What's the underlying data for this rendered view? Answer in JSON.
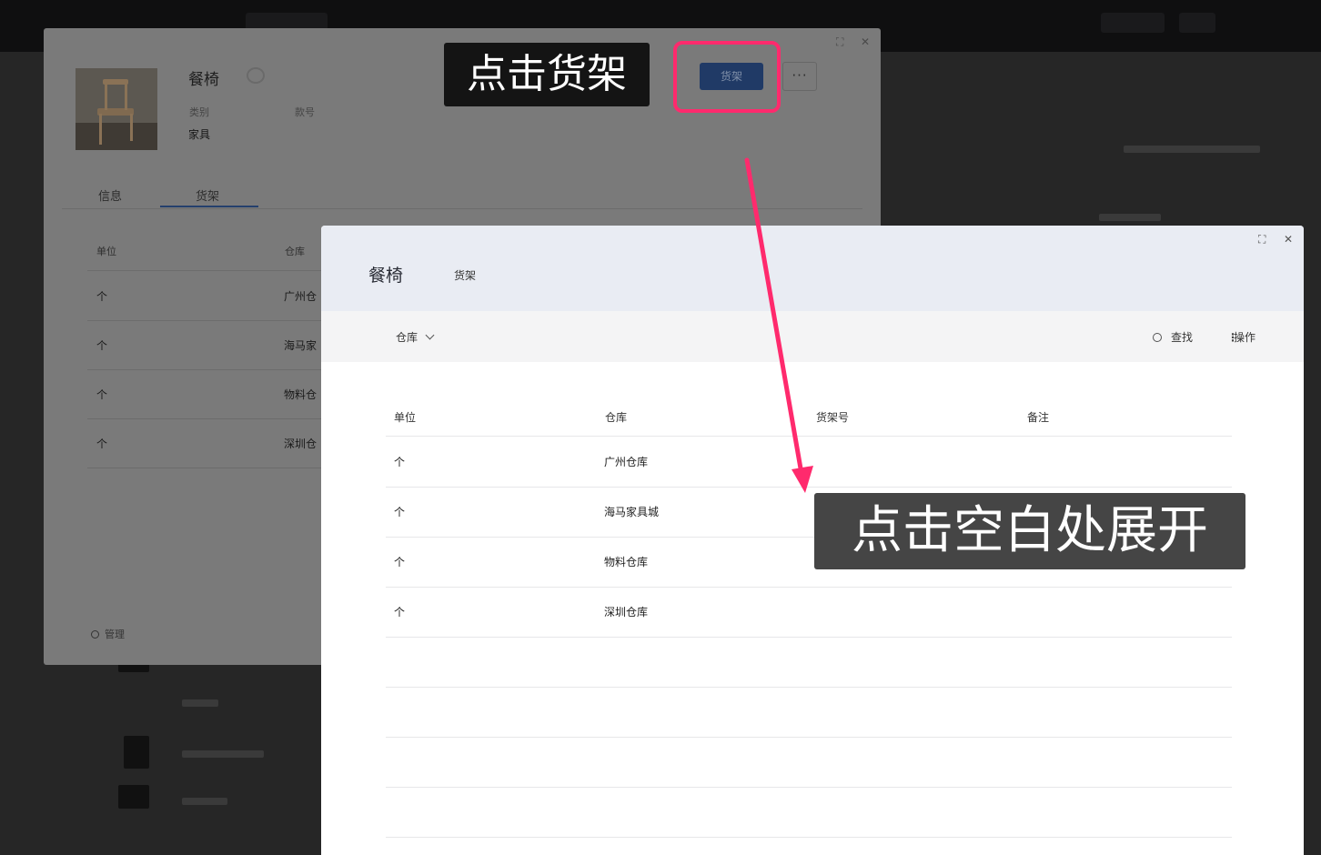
{
  "background_app": {
    "nav_items": [
      "",
      "",
      "",
      "",
      ""
    ]
  },
  "product_dialog": {
    "title": "餐椅",
    "fields": [
      {
        "label": "类别",
        "value": "家具"
      },
      {
        "label": "款号",
        "value": ""
      }
    ],
    "primary_button": "货架",
    "more_button": "···",
    "tabs": [
      {
        "label": "信息",
        "active": false
      },
      {
        "label": "货架",
        "active": true
      }
    ],
    "table": {
      "columns": [
        "单位",
        "仓库"
      ],
      "rows": [
        [
          "个",
          "广州仓"
        ],
        [
          "个",
          "海马家"
        ],
        [
          "个",
          "物料仓"
        ],
        [
          "个",
          "深圳仓"
        ]
      ]
    },
    "footer_link": "管理"
  },
  "shelf_dialog": {
    "title": "餐椅",
    "subtitle": "货架",
    "controls": {
      "maximize": "⛶",
      "close": "✕"
    },
    "toolbar": {
      "filter_label": "仓库",
      "search_label": "查找",
      "ops_label": "操作"
    },
    "table": {
      "columns": [
        "单位",
        "仓库",
        "货架号",
        "备注"
      ],
      "rows": [
        [
          "个",
          "广州仓库",
          "",
          ""
        ],
        [
          "个",
          "海马家具城",
          "",
          ""
        ],
        [
          "个",
          "物料仓库",
          "",
          ""
        ],
        [
          "个",
          "深圳仓库",
          "",
          ""
        ]
      ]
    }
  },
  "annotations": {
    "step1": "点击货架",
    "step2": "点击空白处展开",
    "highlight_color": "#ff2a6d"
  }
}
